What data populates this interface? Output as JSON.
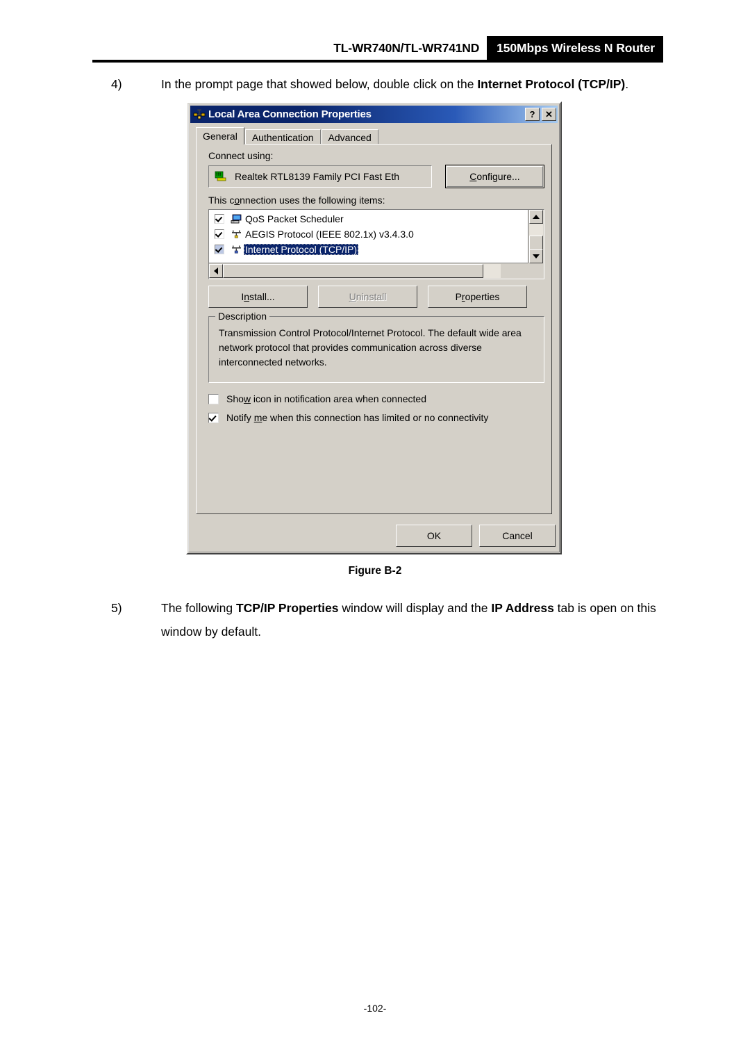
{
  "header": {
    "model": "TL-WR740N/TL-WR741ND",
    "banner": "150Mbps Wireless N Router"
  },
  "steps": {
    "four": {
      "number": "4)",
      "text_before": "In the prompt page that showed below, double click on the ",
      "bold": "Internet Protocol (TCP/IP)",
      "text_after": "."
    },
    "five": {
      "number": "5)",
      "t1": "The following ",
      "b1": "TCP/IP Properties",
      "t2": " window will display and the ",
      "b2": "IP Address",
      "t3": " tab is open on this window by default."
    }
  },
  "figure_caption": "Figure B-2",
  "page_number": "-102-",
  "dialog": {
    "title": "Local Area Connection   Properties",
    "titlebar_icon": "network-connection-icon",
    "help_button": "?",
    "close_button": "✕",
    "tabs": [
      {
        "label": "General",
        "active": true
      },
      {
        "label": "Authentication",
        "active": false
      },
      {
        "label": "Advanced",
        "active": false
      }
    ],
    "connect_using": {
      "label": "Connect using:",
      "adapter": "Realtek RTL8139 Family PCI Fast Eth",
      "configure_button": "Configure..."
    },
    "items_label": "This connection uses the following items:",
    "items": [
      {
        "label": "QoS Packet Scheduler",
        "checked": true,
        "selected": false,
        "icon": "computer-icon"
      },
      {
        "label": "AEGIS Protocol (IEEE 802.1x) v3.4.3.0",
        "checked": true,
        "selected": false,
        "icon": "protocol-icon"
      },
      {
        "label": "Internet Protocol (TCP/IP)",
        "checked": true,
        "selected": true,
        "icon": "protocol-icon"
      }
    ],
    "buttons": {
      "install": "Install...",
      "uninstall": "Uninstall",
      "properties": "Properties",
      "ok": "OK",
      "cancel": "Cancel"
    },
    "description": {
      "title": "Description",
      "text": "Transmission Control Protocol/Internet Protocol. The default wide area network protocol that provides communication across diverse interconnected networks."
    },
    "options": [
      {
        "label": "Show icon in notification area when connected",
        "checked": false
      },
      {
        "label": "Notify me when this connection has limited or no connectivity",
        "checked": true
      }
    ],
    "colors": {
      "face": "#d4d0c8",
      "titlebar_start": "#0a246a",
      "titlebar_end": "#a6caf0",
      "selection": "#0a246a"
    }
  }
}
